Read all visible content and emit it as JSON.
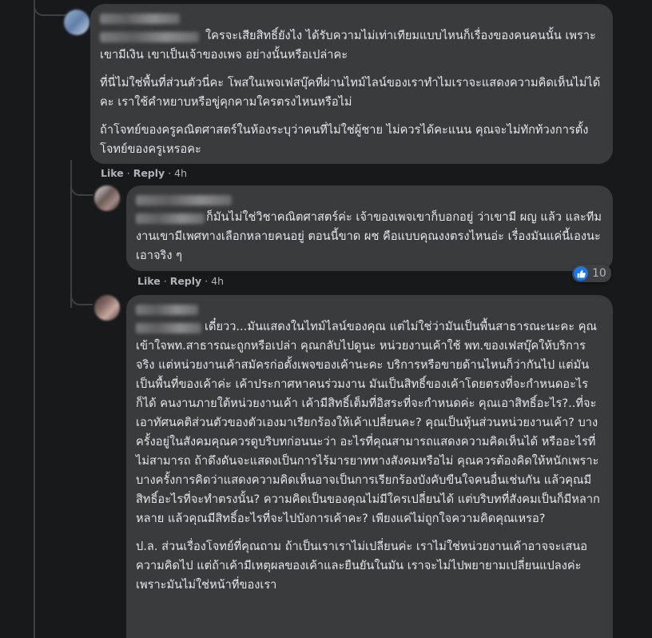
{
  "comments": [
    {
      "paragraphs": [
        "ใครจะเสียสิทธิ์ยังไง ได้รับความไม่เท่าเทียมแบบไหนก็เรื่องของคนคนนั้น เพราะเขามีเงิน เขาเป็นเจ้าของเพจ อย่างนั้นหรือเปล่าคะ",
        "ที่นี่ไม่ใช่พื้นที่ส่วนตัวนี่คะ โพสในเพจเฟสบุ๊คที่ผ่านไทม์ไลน์ของเราทำไมเราจะแสดงความคิดเห็นไม่ได้คะ เราใช้คำหยาบหรือขู่คุกคามใครตรงไหนหรือไม่",
        "ถ้าโจทย์ของครูคณิตศาสตร์ในห้องระบุว่าคนที่ไม่ใช่ผู้ชาย ไม่ควรได้คะแนน คุณจะไม่ทักท้วงการตั้งโจทย์ของครูเหรอคะ"
      ],
      "actions": {
        "like": "Like",
        "reply": "Reply",
        "time": "4h"
      }
    },
    {
      "paragraphs": [
        "ก็มันไม่ใช่วิชาคณิตศาสตร์ค่ะ เจ้าของเพจเขาก็บอกอยู่ ว่าเขามี ผญ แล้ว และทีมงานเขามีเพศทางเลือกหลายคนอยู่ ตอนนี้ขาด ผช คือแบบคุณงงตรงไหนอ่ะ เรื่องมันแค่นี้เองนะเอาจริง ๆ"
      ],
      "actions": {
        "like": "Like",
        "reply": "Reply",
        "time": "4h"
      },
      "reaction": {
        "icon": "thumbs-up-icon",
        "count": "10",
        "color": "#1877f2"
      }
    },
    {
      "paragraphs": [
        "เดี๋ยวว...มันแสดงในไทม์ไลน์ของคุณ แต่ไม่ใช่ว่ามันเป็นพื้นสาธารณะนะคะ คุณเข้าใจพท.สาธารณะถูกหรือเปล่า คุณกลับไปดูนะ หน่วยงานเค้าใช้ พท.ของเฟสบุ๊คให้บริการจริง แต่หน่วยงานเค้าสมัครก่อตั้งเพจของเค้านะคะ บริการหรือขายด้านไหนก็ว่ากันไป แต่มันเป็นพื้นที่ของเค้าค่ะ เค้าประกาศหาคนร่วมงาน มันเป็นสิทธิ์ของเค้าโดยตรงที่จะกำหนดอะไรก็ได้ คนงานภายใต้หน่วยงานเค้า เค้ามีสิทธิ์เต็มที่อิสระที่จะกำหนดค่ะ คุณเอาสิทธิ์อะไร?..ที่จะเอาทัศนคติส่วนตัวของตัวเองมาเรียกร้องให้เค้าเปลี่ยนคะ? คุณเป็นหุ้นส่วนหน่วยงานเค้า? บางครั้งอยู่ในสังคมคุณควรดูบริบทก่อนนะว่า อะไรที่คุณสามารถแสดงความคิดเห็นได้ หรืออะไรที่ไม่สามารถ ถ้าดึงดันจะแสดงเป็นการไร้มารยาททางสังคมหรือไม่ คุณควรต้องคิดให้หนักเพราะบางครั้งการคิดว่าแสดงความคิดเห็นอาจเป็นการเรียกร้องบังคับขืนใจคนอื่นเช่นกัน แล้วคุณมีสิทธิ์อะไรที่จะทำตรงนั้น? ความคิดเป็นของคุณไม่มีใครเปลี่ยนได้ แต่บริบทที่สังคมเป็นก็มีหลากหลาย แล้วคุณมีสิทธิ์อะไรที่จะไปบังการเค้าคะ? เพียงแค่ไม่ถูกใจความคิดคุณเหรอ?",
        "ป.ล. ส่วนเรื่องโจทย์ที่คุณถาม ถ้าเป็นเราเราไม่เปลี่ยนค่ะ เราไม่ใช่หน่วยงานเค้าอาจจะเสนอความคิดไป แต่ถ้าเค้ามีเหตุผลของเค้าและยืนยันในมัน เราจะไม่ไปพยายามเปลี่ยนแปลงค่ะ เพราะมันไม่ใช่หน้าที่ของเรา"
      ]
    }
  ]
}
